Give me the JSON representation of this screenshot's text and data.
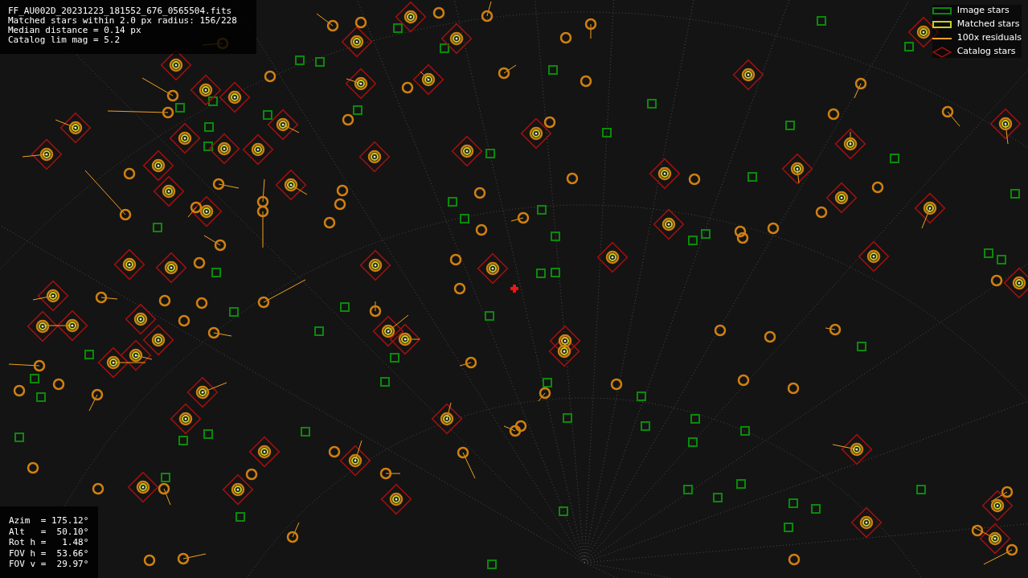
{
  "info": {
    "lines": [
      "FF_AU002D_20231223_181552_676_0565504.fits",
      "Matched stars within 2.0 px radius: 156/228",
      "Median distance = 0.14 px",
      "Catalog lim mag = 5.2"
    ]
  },
  "legend": [
    {
      "kind": "image",
      "label": "Image stars"
    },
    {
      "kind": "matched",
      "label": "Matched stars"
    },
    {
      "kind": "residual",
      "label": "100x residuals"
    },
    {
      "kind": "catalog",
      "label": "Catalog stars"
    }
  ],
  "pointing": {
    "lines": [
      "Azim  = 175.12°",
      "Alt   =  50.10°",
      "Rot h =   1.48°",
      "FOV h =  53.66°",
      "FOV v =  29.97°"
    ]
  }
}
